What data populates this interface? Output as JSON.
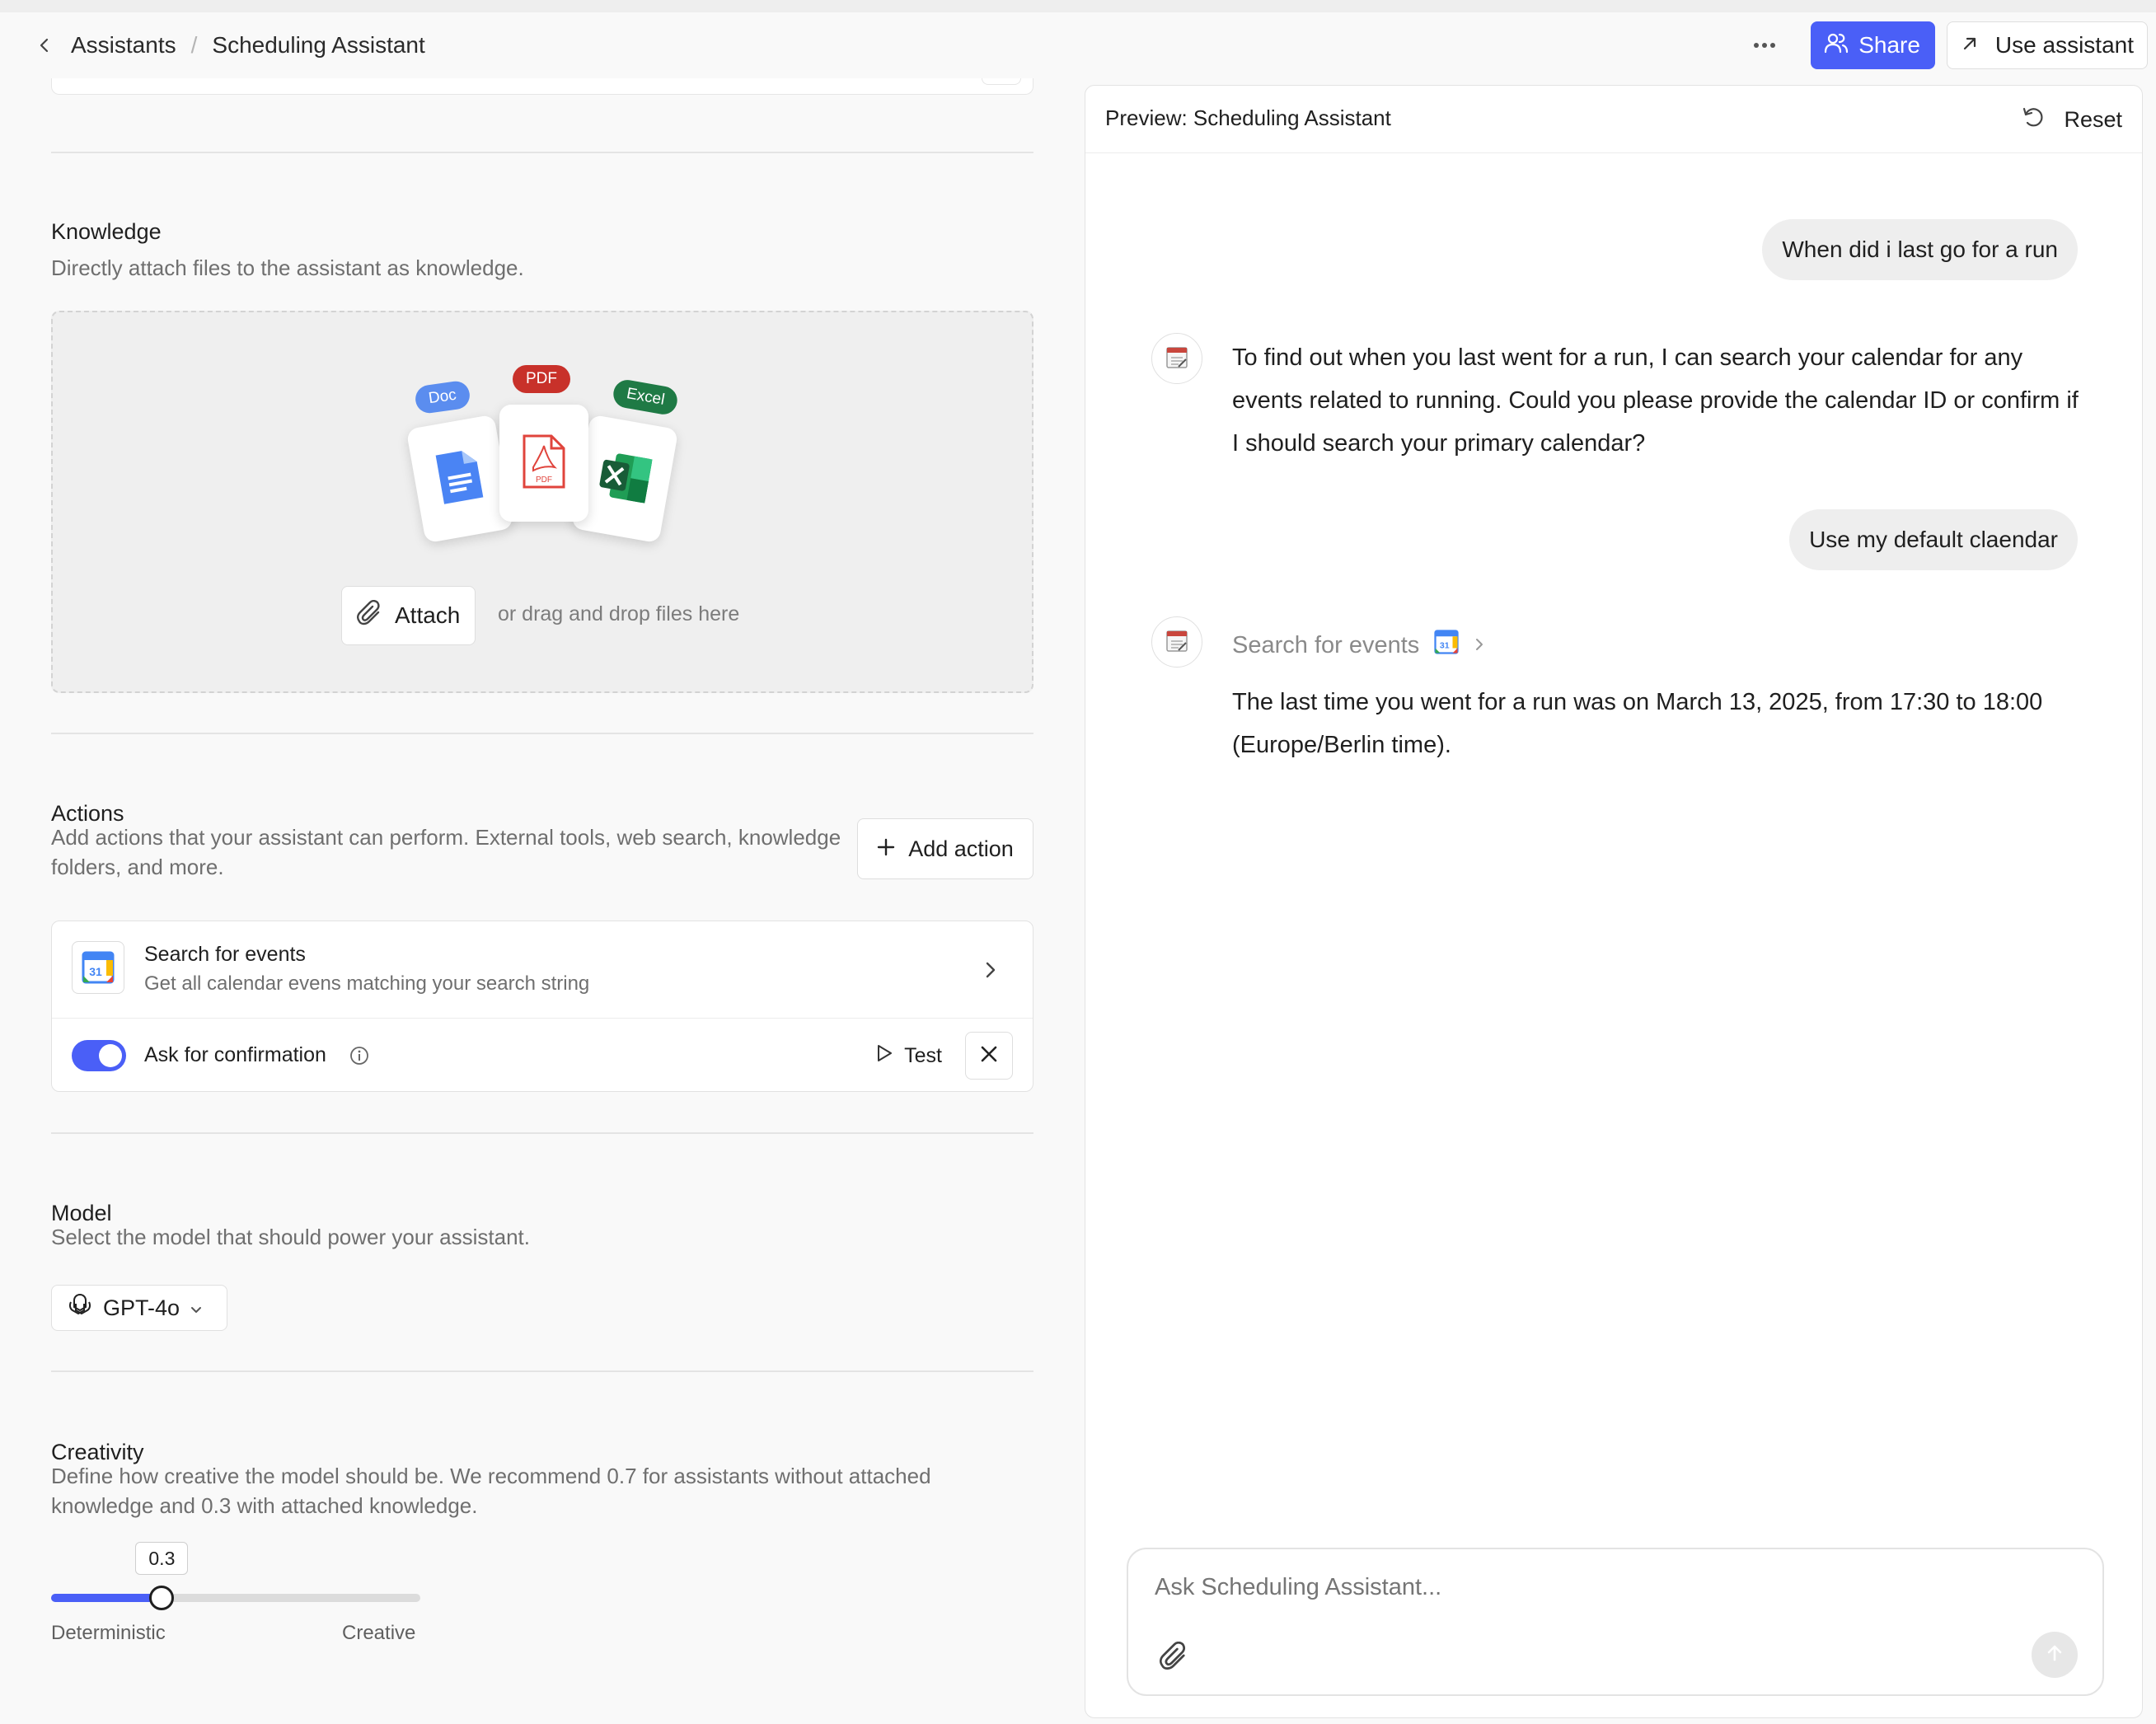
{
  "header": {
    "breadcrumb_root": "Assistants",
    "breadcrumb_sep": "/",
    "breadcrumb_current": "Scheduling Assistant",
    "share_label": "Share",
    "use_label": "Use assistant",
    "accent_color": "#4a5ff7"
  },
  "knowledge": {
    "title": "Knowledge",
    "description": "Directly attach files to the assistant as knowledge.",
    "file_badges": [
      "Doc",
      "PDF",
      "Excel"
    ],
    "attach_label": "Attach",
    "drop_hint": "or drag and drop files here"
  },
  "actions": {
    "title": "Actions",
    "description": "Add actions that your assistant can perform. External tools, web search, knowledge folders, and more.",
    "add_label": "Add action",
    "items": [
      {
        "name": "Search for events",
        "description": "Get all calendar evens matching your search string",
        "confirm_label": "Ask for confirmation",
        "confirm_enabled": true,
        "test_label": "Test",
        "icon": "google-calendar-icon"
      }
    ]
  },
  "model": {
    "title": "Model",
    "description": "Select the model that should power your assistant.",
    "selected": "GPT-4o"
  },
  "creativity": {
    "title": "Creativity",
    "description": "Define how creative the model should be. We recommend 0.7 for assistants without attached knowledge and 0.3 with attached knowledge.",
    "value": 0.3,
    "value_label": "0.3",
    "min_label": "Deterministic",
    "max_label": "Creative"
  },
  "preview": {
    "title": "Preview: Scheduling Assistant",
    "reset_label": "Reset",
    "messages": [
      {
        "role": "user",
        "text": "When did i last go for a run"
      },
      {
        "role": "assistant",
        "text": "To find out when you last went for a run, I can search your calendar for any events related to running. Could you please provide the calendar ID or confirm if I should search your primary calendar?"
      },
      {
        "role": "user",
        "text": "Use my default claendar"
      },
      {
        "role": "assistant",
        "tool": "Search for events",
        "text": "The last time you went for a run was on March 13, 2025, from 17:30 to 18:00 (Europe/Berlin time)."
      }
    ],
    "composer_placeholder": "Ask Scheduling Assistant..."
  }
}
